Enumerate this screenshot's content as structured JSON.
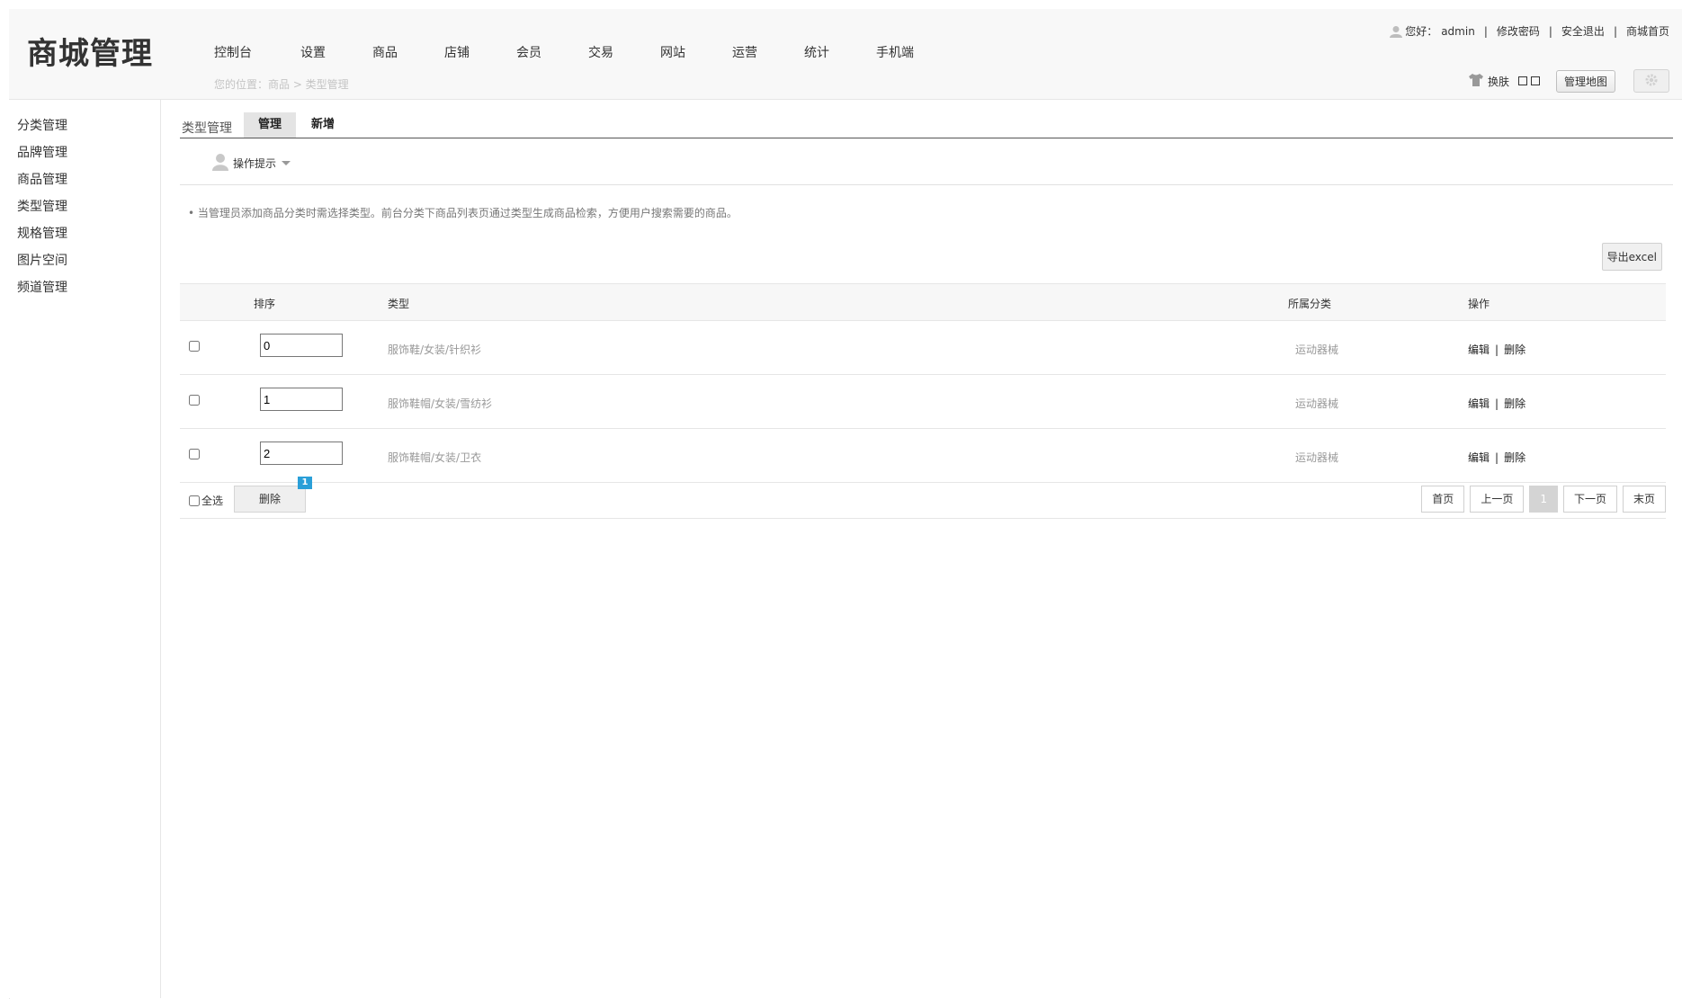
{
  "header": {
    "logo": "商城管理",
    "nav": [
      "控制台",
      "设置",
      "商品",
      "店铺",
      "会员",
      "交易",
      "网站",
      "运营",
      "统计",
      "手机端"
    ],
    "breadcrumb": "您的位置：商品 > 类型管理",
    "greeting": "您好：",
    "username": "admin",
    "change_password": "修改密码",
    "logout": "安全退出",
    "shop_home": "商城首页",
    "skin_label": "换肤",
    "map_button": "管理地图",
    "icons": {
      "user": "user-icon",
      "skin": "shirt-icon",
      "gear": "gear-icon"
    }
  },
  "sidebar": {
    "items": [
      "分类管理",
      "品牌管理",
      "商品管理",
      "类型管理",
      "规格管理",
      "图片空间",
      "频道管理"
    ]
  },
  "tabs": {
    "title": "类型管理",
    "manage": "管理",
    "add": "新增"
  },
  "tips": {
    "label": "操作提示",
    "notice": "• 当管理员添加商品分类时需选择类型。前台分类下商品列表页通过类型生成商品检索，方便用户搜索需要的商品。"
  },
  "export_button": "导出excel",
  "table": {
    "headers": {
      "sort": "排序",
      "type": "类型",
      "category": "所属分类",
      "ops": "操作"
    },
    "rows": [
      {
        "sort": "0",
        "type": "服饰鞋/女装/针织衫",
        "category": "运动器械",
        "edit": "编辑",
        "delete": "删除"
      },
      {
        "sort": "1",
        "type": "服饰鞋帽/女装/雪纺衫",
        "category": "运动器械",
        "edit": "编辑",
        "delete": "删除"
      },
      {
        "sort": "2",
        "type": "服饰鞋帽/女装/卫衣",
        "category": "运动器械",
        "edit": "编辑",
        "delete": "删除"
      }
    ]
  },
  "footer": {
    "select_all": "全选",
    "delete": "删除",
    "badge": "1",
    "pager": {
      "first": "首页",
      "prev": "上一页",
      "current": "1",
      "next": "下一页",
      "last": "末页"
    }
  },
  "colors": {
    "badge": "#2a9fd8",
    "border": "#e6e6e6"
  }
}
